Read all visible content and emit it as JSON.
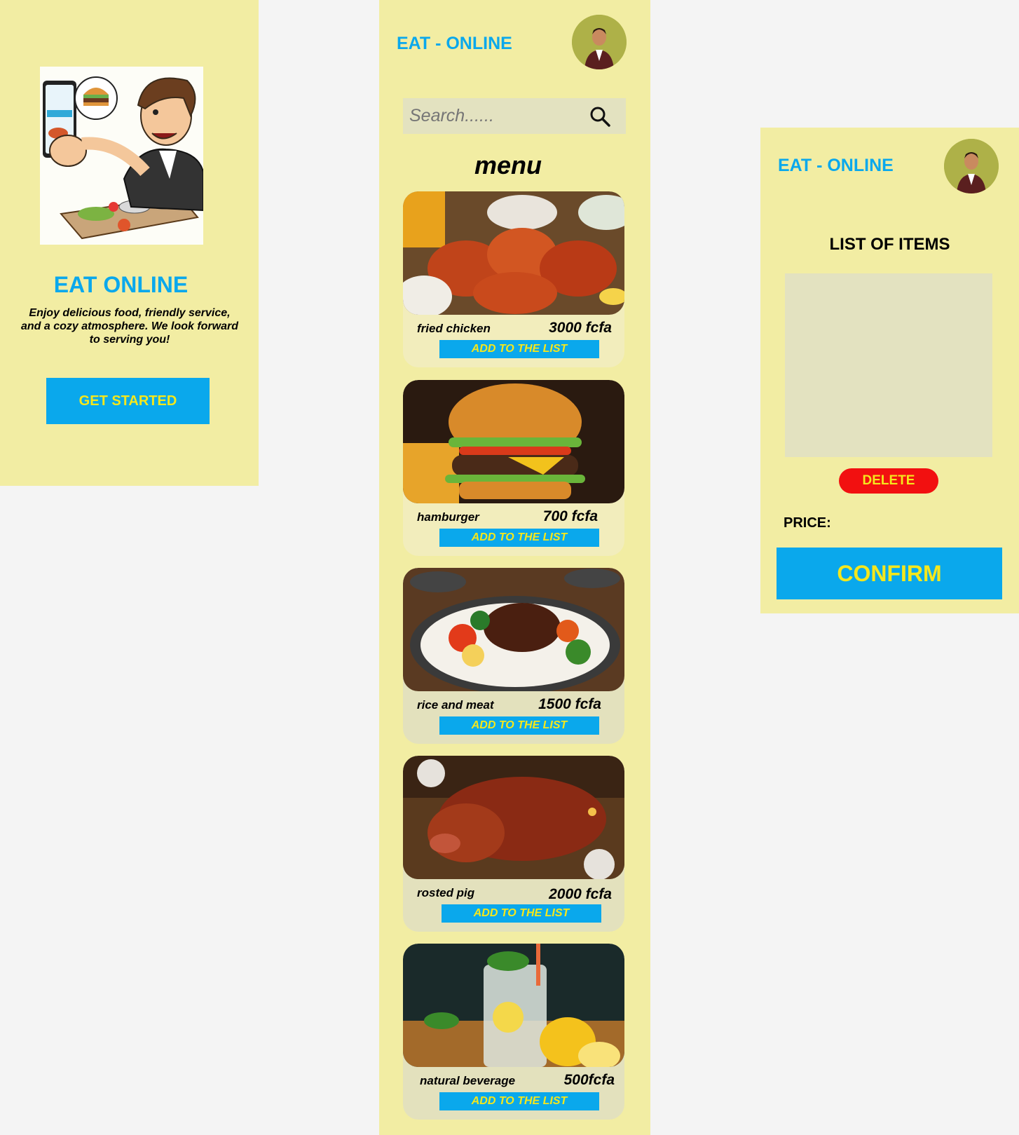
{
  "welcome": {
    "hero_image": "man-ordering-food-illustration",
    "title": "EAT ONLINE",
    "text": "Enjoy delicious food, friendly service, and a cozy atmosphere. We look forward to serving you!",
    "get_started_label": "GET STARTED"
  },
  "menu_screen": {
    "brand": "EAT - ONLINE",
    "avatar": "user-avatar",
    "search": {
      "placeholder": "Search......",
      "icon": "search-icon"
    },
    "menu_title": "menu",
    "items": [
      {
        "name": "fried chicken",
        "price": "3000  fcfa",
        "button": "ADD TO THE LIST",
        "image": "fried-chicken-photo"
      },
      {
        "name": "hamburger",
        "price": "700 fcfa",
        "button": "ADD TO THE LIST",
        "image": "hamburger-photo"
      },
      {
        "name": "rice and meat",
        "price": "1500 fcfa",
        "button": "ADD TO THE LIST",
        "image": "rice-and-meat-photo"
      },
      {
        "name": "rosted pig",
        "price": "2000 fcfa",
        "button": "ADD TO THE LIST",
        "image": "roasted-pig-photo"
      },
      {
        "name": "natural beverage",
        "price": "500fcfa",
        "button": "ADD TO THE LIST",
        "image": "lemonade-photo"
      }
    ]
  },
  "list_screen": {
    "brand": "EAT - ONLINE",
    "avatar": "user-avatar",
    "title": "LIST OF ITEMS",
    "delete_label": "DELETE",
    "price_label": "PRICE:",
    "confirm_label": "CONFIRM"
  },
  "colors": {
    "panel": "#f2eda3",
    "accent_blue": "#0aa8ec",
    "accent_yellow": "#f5e71c",
    "delete_red": "#f21010",
    "box_gray": "#e3e2c0",
    "avatar_olive": "#aeb148"
  }
}
